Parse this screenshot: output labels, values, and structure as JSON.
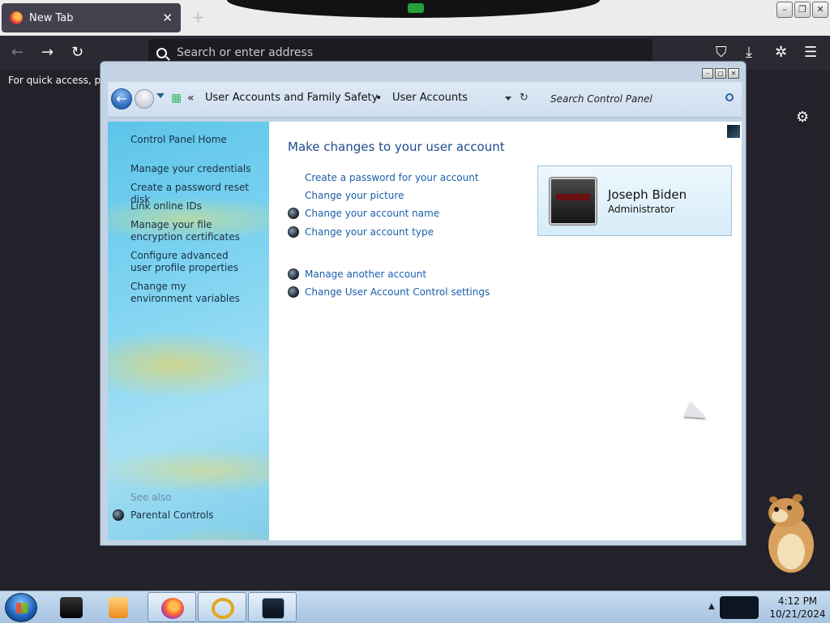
{
  "browser": {
    "tab_title": "New Tab",
    "tab_close": "✕",
    "new_tab": "+",
    "window_buttons": [
      "–",
      "❐",
      "✕"
    ],
    "nav": {
      "back": "←",
      "forward": "→",
      "reload": "↻"
    },
    "url_placeholder": "Search or enter address",
    "toolbar_icons": {
      "pocket": "⛉",
      "downloads": "⤓",
      "extensions": "✲",
      "menu": "☰"
    },
    "quick_access_text": "For quick access, plac",
    "settings": "⚙"
  },
  "control_panel": {
    "title_buttons": [
      "–",
      "□",
      "✕"
    ],
    "breadcrumb": {
      "overflow": "«",
      "items": [
        "User Accounts and Family Safety",
        "User Accounts"
      ],
      "separator": "•"
    },
    "refresh": "↻",
    "search_placeholder": "Search Control Panel",
    "side": {
      "links": [
        "Control Panel Home",
        "Manage your credentials",
        "Create a password reset disk",
        "Link online IDs",
        "Manage your file encryption certificates",
        "Configure advanced user profile properties",
        "Change my environment variables"
      ],
      "see_also": "See also",
      "parental_controls": "Parental Controls"
    },
    "main": {
      "title": "Make changes to your user account",
      "tasks": [
        {
          "label": "Create a password for your account",
          "shield": false
        },
        {
          "label": "Change your picture",
          "shield": false
        },
        {
          "label": "Change your account name",
          "shield": true
        },
        {
          "label": "Change your account type",
          "shield": true
        },
        {
          "label": "Manage another account",
          "shield": true
        },
        {
          "label": "Change User Account Control settings",
          "shield": true
        }
      ]
    },
    "account": {
      "name": "Joseph Biden",
      "role": "Administrator"
    }
  },
  "taskbar": {
    "clock": {
      "time": "4:12 PM",
      "date": "10/21/2024"
    },
    "tray_chevron": "▲"
  }
}
